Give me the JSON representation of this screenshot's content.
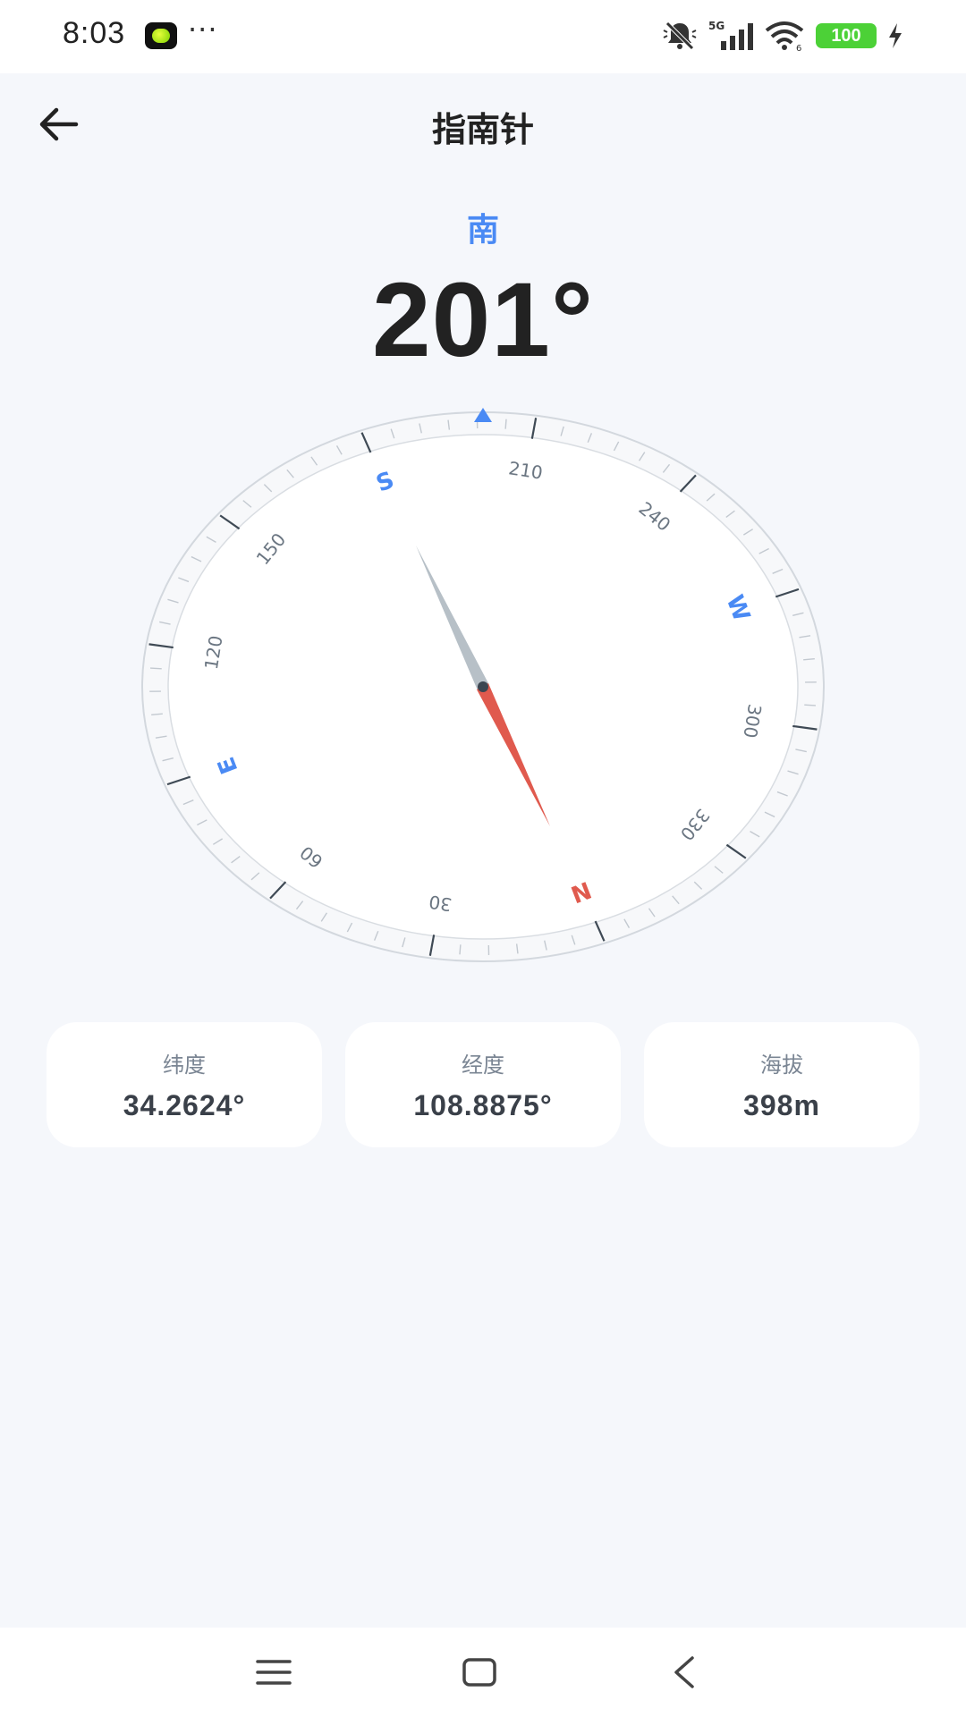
{
  "status_bar": {
    "time": "8:03",
    "more": "···",
    "signal_label": "5G",
    "battery": "100",
    "icons": [
      "bell-muted-icon",
      "signal-icon",
      "wifi-icon",
      "battery-icon",
      "charging-icon"
    ]
  },
  "header": {
    "title": "指南针",
    "back_icon": "arrow-left-icon"
  },
  "compass": {
    "direction": "南",
    "heading_display": "201°",
    "heading_degrees": 201,
    "cardinals": {
      "N": "N",
      "E": "E",
      "S": "S",
      "W": "W"
    },
    "degree_labels": [
      "30",
      "60",
      "120",
      "150",
      "210",
      "240",
      "300",
      "330"
    ],
    "colors": {
      "accent": "#4a8af4",
      "north": "#e05a4e",
      "needle_tail": "#b7c0c7"
    }
  },
  "info": {
    "latitude": {
      "label": "纬度",
      "value": "34.2624°"
    },
    "longitude": {
      "label": "经度",
      "value": "108.8875°"
    },
    "altitude": {
      "label": "海拔",
      "value": "398m"
    }
  },
  "nav": {
    "icons": [
      "menu-icon",
      "home-icon",
      "back-icon"
    ]
  }
}
